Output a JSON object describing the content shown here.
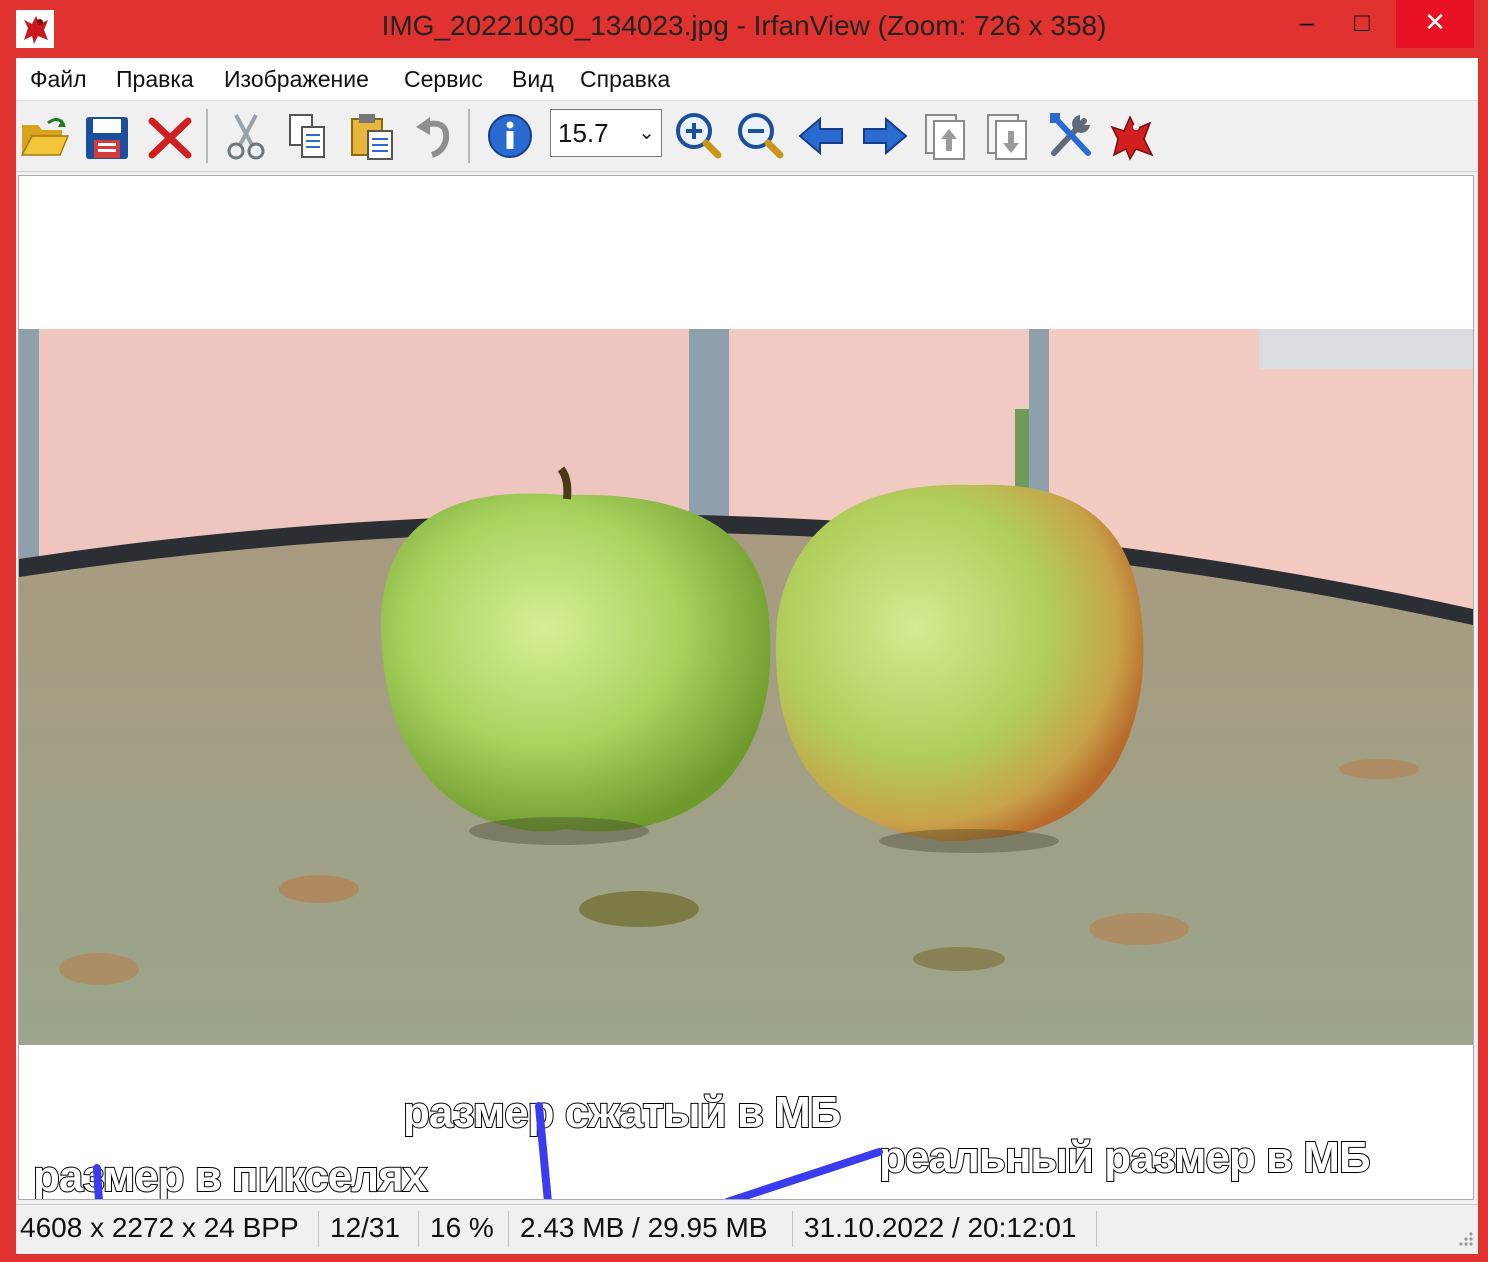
{
  "window": {
    "title": "IMG_20221030_134023.jpg - IrfanView (Zoom: 726 x 358)",
    "minimize": "–",
    "maximize": "□",
    "close": "✕",
    "accent": "#e0322f"
  },
  "menu": {
    "items": [
      "Файл",
      "Правка",
      "Изображение",
      "Сервис",
      "Вид",
      "Справка"
    ]
  },
  "toolbar": {
    "zoom_value": "15.7",
    "icons": [
      "open-folder-icon",
      "save-icon",
      "delete-icon",
      "cut-icon",
      "copy-icon",
      "paste-icon",
      "undo-icon",
      "info-icon",
      "zoom-in-icon",
      "zoom-out-icon",
      "previous-arrow-icon",
      "next-arrow-icon",
      "page-up-icon",
      "page-down-icon",
      "settings-tools-icon",
      "irfanview-logo-icon"
    ]
  },
  "annotations": {
    "pixels": "размер в пикселях",
    "compressed": "размер сжатый в МБ",
    "real": "реальный размер в МБ",
    "line_color": "#3b3bf0"
  },
  "status": {
    "dimensions": "4608 x 2272 x 24 BPP",
    "index": "12/31",
    "zoom": "16 %",
    "size": "2.43 MB / 29.95 MB",
    "datetime": "31.10.2022 / 20:12:01"
  }
}
